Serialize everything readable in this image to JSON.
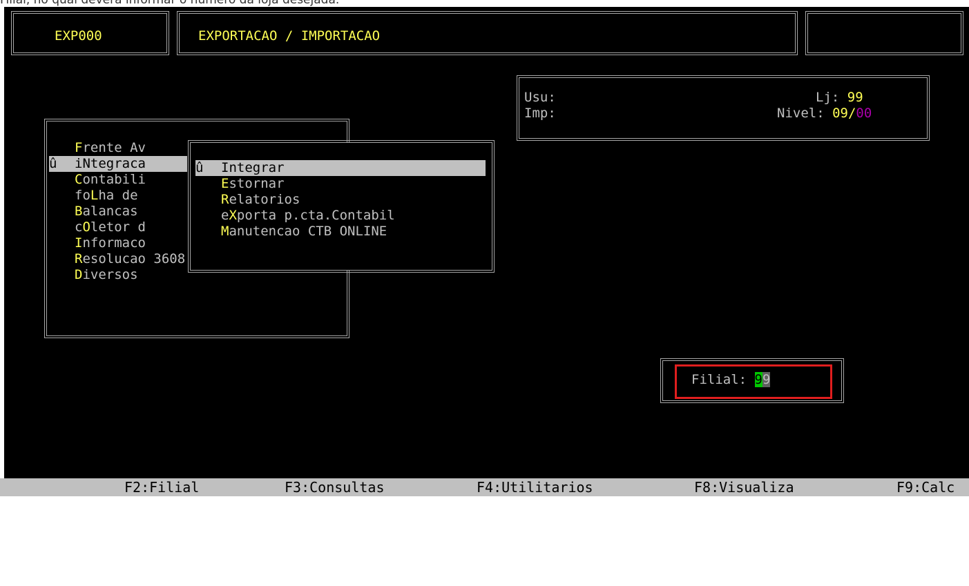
{
  "caption": "Filial, no qual deverá informar o número da loja desejada.",
  "header": {
    "program_code": "EXP000",
    "title": "EXPORTACAO / IMPORTACAO",
    "right_box": ""
  },
  "info_panel": {
    "usu_label": "Usu:",
    "imp_label": "Imp:",
    "lj_label": "Lj:",
    "lj_value": "99",
    "nivel_label": "Nivel:",
    "nivel_value_a": "09/",
    "nivel_value_b": "00"
  },
  "main_menu": {
    "items": [
      {
        "marker": " ",
        "hotkey": "F",
        "before": "",
        "after": "rente Av"
      },
      {
        "marker": "û",
        "hotkey": "N",
        "before": "i",
        "after": "tegraca"
      },
      {
        "marker": " ",
        "hotkey": "C",
        "before": "",
        "after": "ontabili"
      },
      {
        "marker": " ",
        "hotkey": "L",
        "before": "fo",
        "after": "ha de"
      },
      {
        "marker": " ",
        "hotkey": "B",
        "before": "",
        "after": "alancas"
      },
      {
        "marker": " ",
        "hotkey": "O",
        "before": "c",
        "after": "letor d"
      },
      {
        "marker": " ",
        "hotkey": "I",
        "before": "",
        "after": "nformaco"
      },
      {
        "marker": " ",
        "hotkey": "R",
        "before": "",
        "after": "esolucao 3608"
      },
      {
        "marker": " ",
        "hotkey": "D",
        "before": "",
        "after": "iversos"
      }
    ]
  },
  "sub_menu": {
    "items": [
      {
        "marker": "û",
        "hotkey": "I",
        "before": "",
        "after": "ntegrar"
      },
      {
        "marker": " ",
        "hotkey": "E",
        "before": "",
        "after": "stornar"
      },
      {
        "marker": " ",
        "hotkey": "R",
        "before": "",
        "after": "elatorios"
      },
      {
        "marker": " ",
        "hotkey": "X",
        "before": "e",
        "after": "porta p.cta.Contabil"
      },
      {
        "marker": " ",
        "hotkey": "M",
        "before": "",
        "after": "anutencao CTB ONLINE"
      }
    ]
  },
  "filial_prompt": {
    "label": "Filial:",
    "value_first": "9",
    "value_rest": "9"
  },
  "function_keys": [
    "F2:Filial",
    "F3:Consultas",
    "F4:Utilitarios",
    "F8:Visualiza",
    "F9:Calc"
  ],
  "colors": {
    "hotkey": "#ffff55",
    "cursor": "#00c800",
    "highlight_border": "#e01e1e",
    "background": "#000000"
  }
}
